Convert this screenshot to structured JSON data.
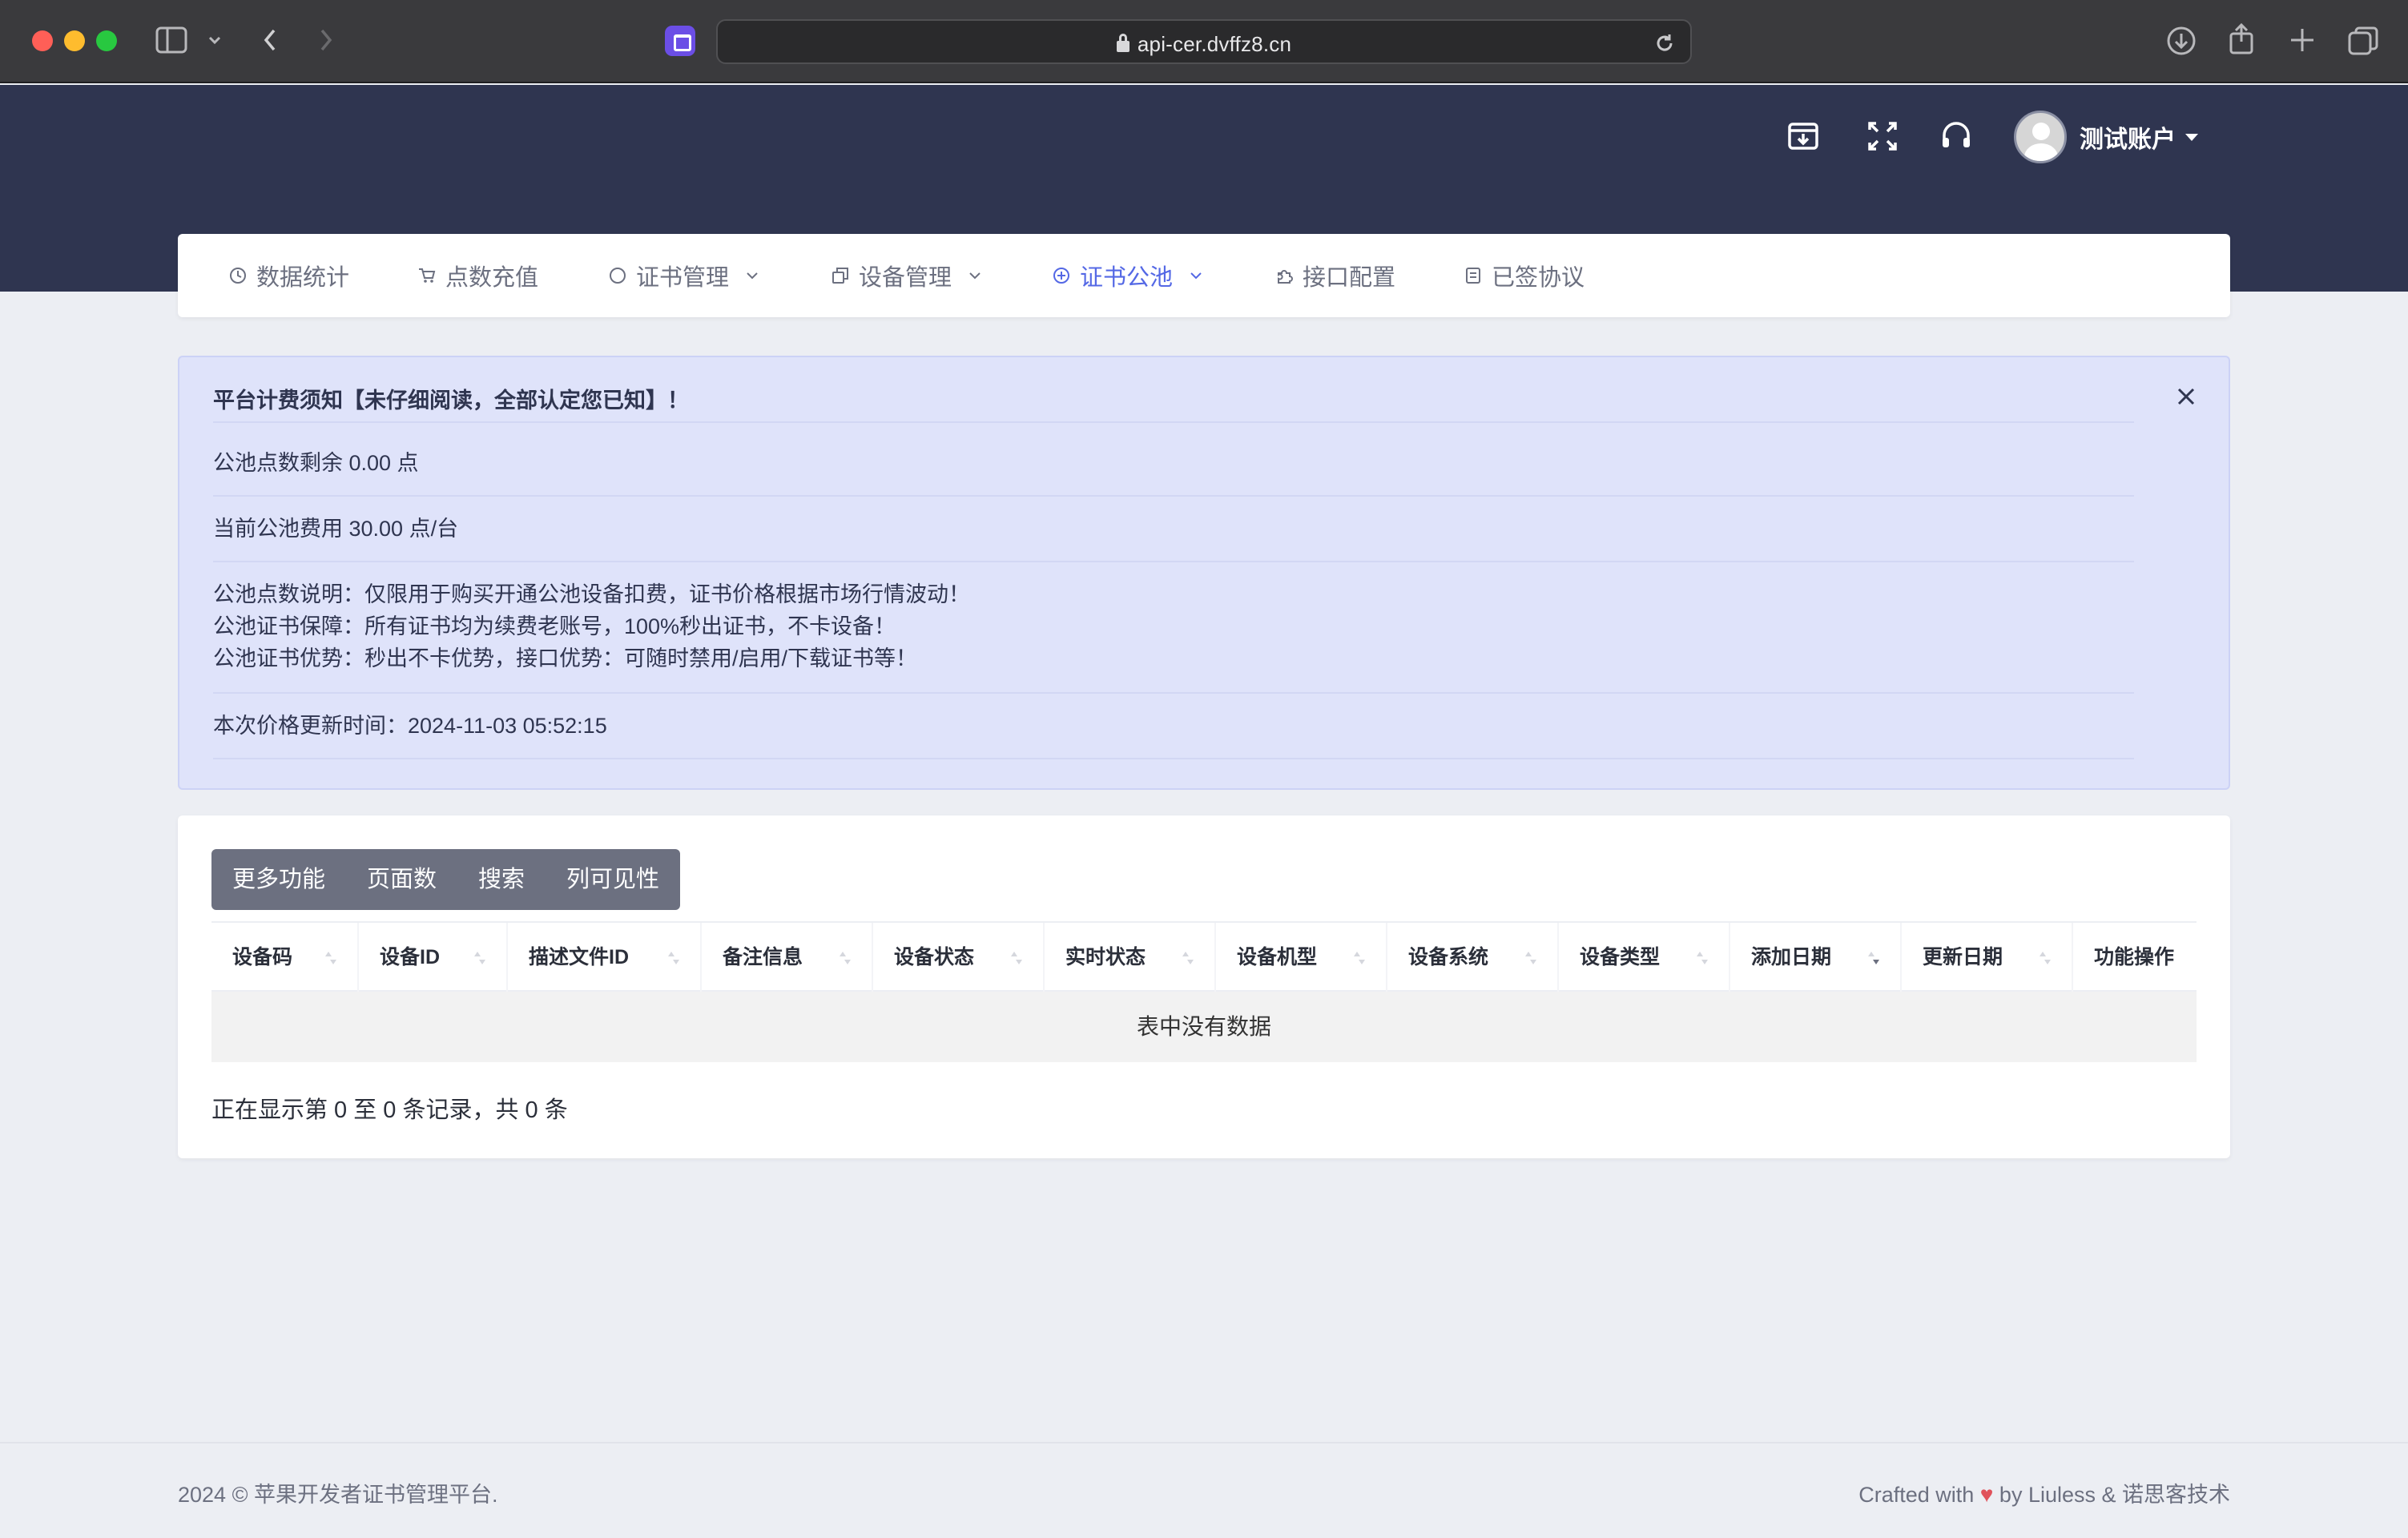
{
  "browser": {
    "url": "api-cer.dvffz8.cn"
  },
  "header": {
    "user_name": "测试账户"
  },
  "nav": {
    "items": [
      {
        "label": "数据统计",
        "icon": "clock-icon",
        "has_dropdown": false,
        "active": false
      },
      {
        "label": "点数充值",
        "icon": "cart-icon",
        "has_dropdown": false,
        "active": false
      },
      {
        "label": "证书管理",
        "icon": "circle-icon",
        "has_dropdown": true,
        "active": false
      },
      {
        "label": "设备管理",
        "icon": "copy-icon",
        "has_dropdown": true,
        "active": false
      },
      {
        "label": "证书公池",
        "icon": "plus-circle-icon",
        "has_dropdown": true,
        "active": true
      },
      {
        "label": "接口配置",
        "icon": "puzzle-icon",
        "has_dropdown": false,
        "active": false
      },
      {
        "label": "已签协议",
        "icon": "document-icon",
        "has_dropdown": false,
        "active": false
      }
    ]
  },
  "notice": {
    "title": "平台计费须知【未仔细阅读，全部认定您已知】！",
    "balance": "公池点数剩余 0.00 点",
    "fee": "当前公池费用 30.00 点/台",
    "line1": "公池点数说明：仅限用于购买开通公池设备扣费，证书价格根据市场行情波动！",
    "line2": "公池证书保障：所有证书均为续费老账号，100%秒出证书，不卡设备！",
    "line3": "公池证书优势：秒出不卡优势，接口优势：可随时禁用/启用/下载证书等！",
    "update_time": "本次价格更新时间：2024-11-03 05:52:15"
  },
  "toolbar": {
    "more": "更多功能",
    "page_size": "页面数",
    "search": "搜索",
    "columns": "列可见性"
  },
  "table": {
    "headers": [
      "设备码",
      "设备ID",
      "描述文件ID",
      "备注信息",
      "设备状态",
      "实时状态",
      "设备机型",
      "设备系统",
      "设备类型",
      "添加日期",
      "更新日期",
      "功能操作"
    ],
    "empty": "表中没有数据",
    "info": "正在显示第 0 至 0 条记录，共 0 条"
  },
  "footer": {
    "left": "2024 © 苹果开发者证书管理平台.",
    "right_prefix": "Crafted with",
    "right_suffix": "by Liuless & 诺思客技术"
  },
  "colors": {
    "header_bg": "#2f3550",
    "accent": "#5468e5",
    "notice_bg": "#dfe3fa",
    "button_bg": "#6c7080",
    "heart": "#e0525b"
  }
}
